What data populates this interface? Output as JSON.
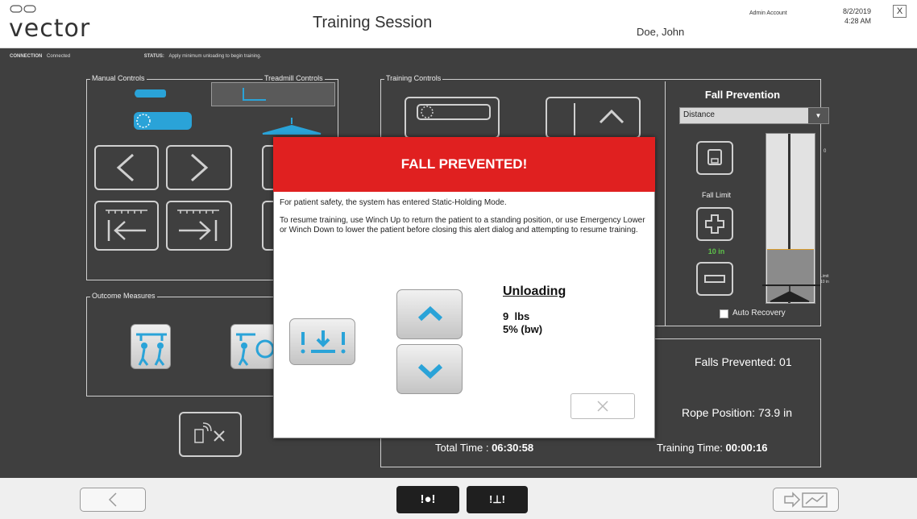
{
  "header": {
    "logo": "vector",
    "title": "Training Session",
    "user": "Doe, John",
    "account": "Admin Account",
    "date": "8/2/2019",
    "time": "4:28 AM",
    "close_label": "X"
  },
  "status": {
    "connection_label": "CONNECTION",
    "connection_value": "Connected",
    "status_label": "STATUS:",
    "status_value": "Apply minimum unloading to begin training."
  },
  "panels": {
    "manual_controls": "Manual Controls",
    "treadmill_controls": "Treadmill Controls",
    "outcome_measures": "Outcome Measures",
    "training_controls": "Training Controls"
  },
  "fall_prevention": {
    "title": "Fall Prevention",
    "dropdown_value": "Distance",
    "fall_limit_label": "Fall Limit",
    "fall_limit_value": "10 in",
    "gauge_zero": "0",
    "gauge_limit": "Limit",
    "gauge_limit_value": "10 in",
    "auto_recovery_label": "Auto Recovery"
  },
  "info": {
    "falls_prevented": "Falls Prevented: 01",
    "rope_position": "Rope Position: 73.9 in",
    "total_time_label": "Total Time : ",
    "total_time_value": "06:30:58",
    "training_time_label": "Training Time: ",
    "training_time_value": "00:00:16"
  },
  "modal": {
    "title": "FALL PREVENTED!",
    "line1": "For patient safety, the system has entered Static-Holding Mode.",
    "line2": "To resume training, use Winch Up to return the patient to a standing position, or use Emergency Lower or Winch Down to lower the patient before closing this alert dialog and attempting to resume training.",
    "unloading_title": "Unloading",
    "unloading_lbs": "9  lbs",
    "unloading_bw": "5% (bw)"
  },
  "footer": {
    "emergency_label": "!●!",
    "winch_label": "!⊥!"
  },
  "colors": {
    "accent_blue": "#2aa3d8",
    "alert_red": "#e02020",
    "limit_green": "#5ec24a",
    "dark_background": "#3f3f3f"
  }
}
